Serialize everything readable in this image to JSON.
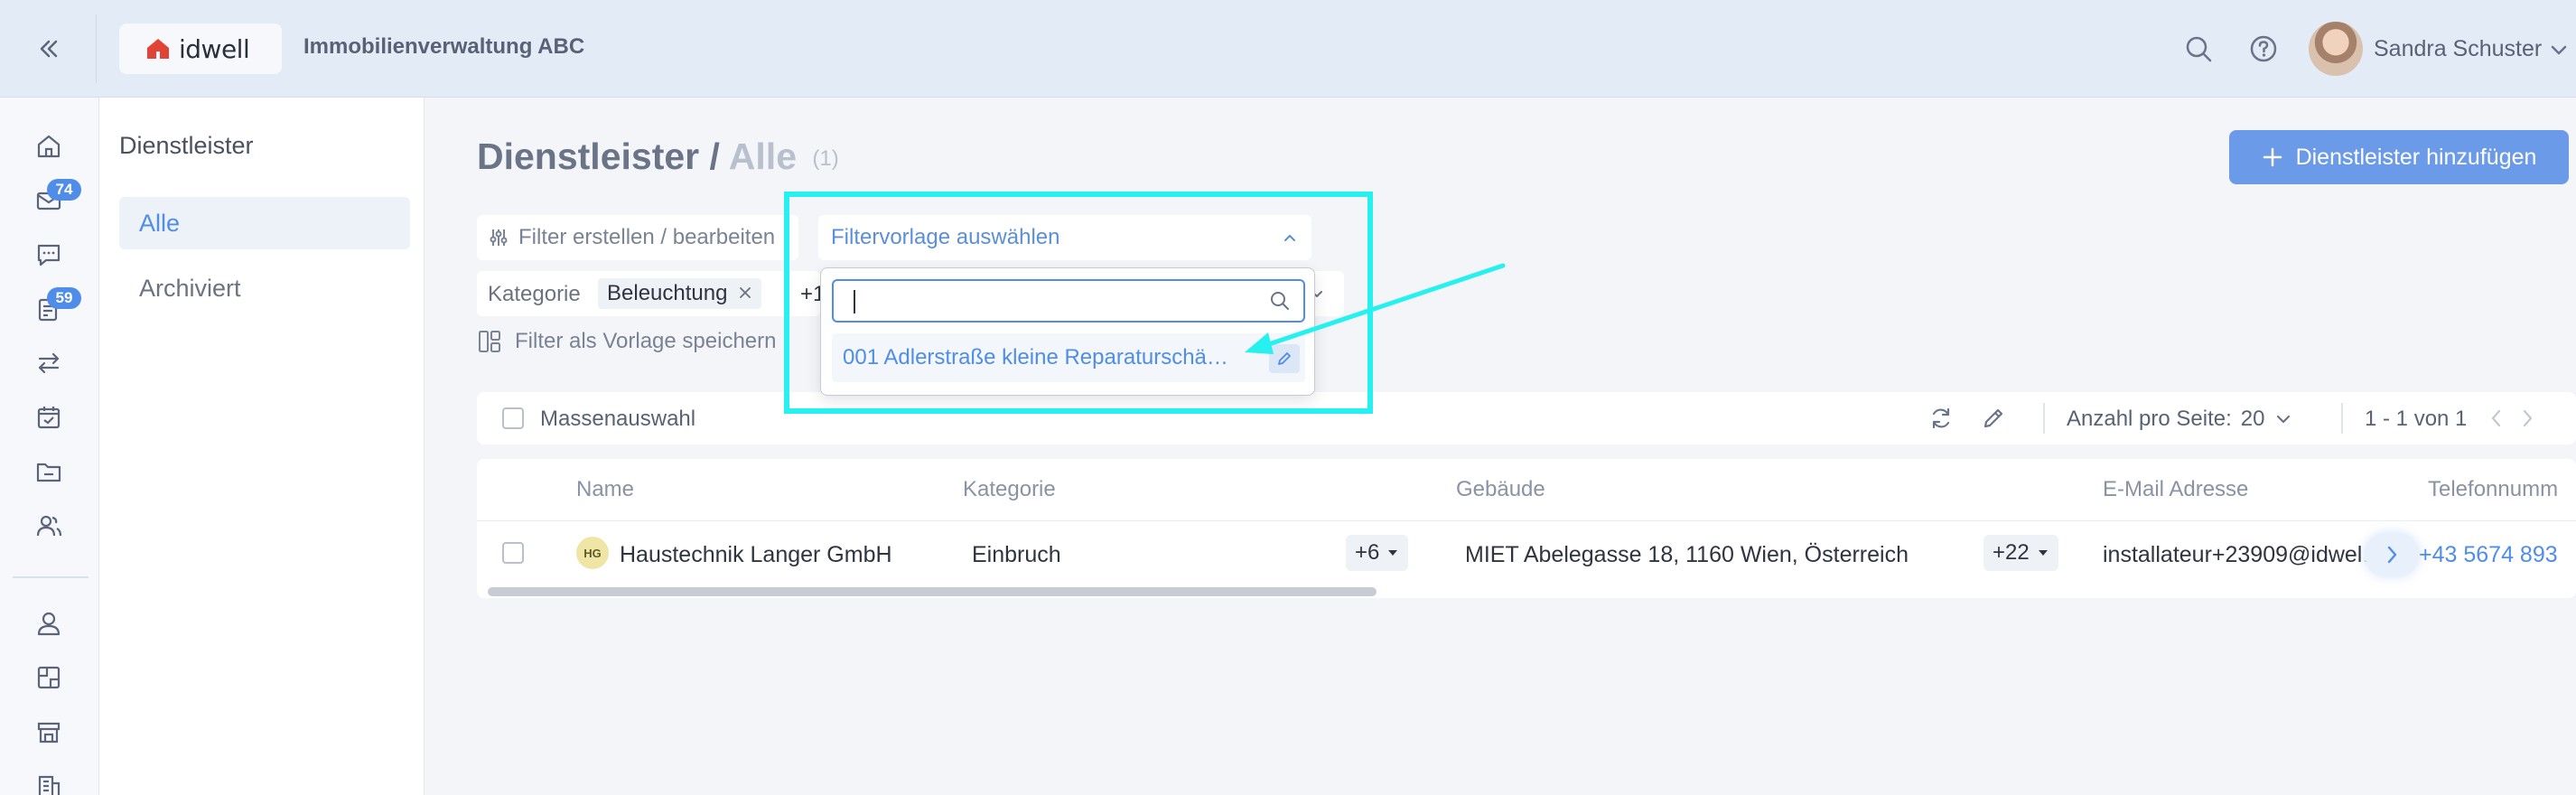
{
  "header": {
    "logo_text": "idwell",
    "company": "Immobilienverwaltung ABC",
    "user_name": "Sandra Schuster",
    "icons": [
      "collapse-icon",
      "search-icon",
      "help-icon",
      "chevron-down-icon"
    ]
  },
  "rail": {
    "icons": [
      "home-icon",
      "inbox-icon",
      "chat-icon",
      "tasks-icon",
      "transfer-icon",
      "calendar-check-icon",
      "folder-icon",
      "users-icon",
      "person-icon",
      "contract-icon",
      "store-icon",
      "building-icon"
    ],
    "badges": {
      "inbox": "74",
      "tasks": "59"
    }
  },
  "subnav": {
    "title": "Dienstleister",
    "items": [
      {
        "label": "Alle",
        "active": true
      },
      {
        "label": "Archiviert",
        "active": false
      }
    ]
  },
  "page": {
    "title": "Dienstleister",
    "separator": "/",
    "subtitle": "Alle",
    "count": "(1)",
    "add_button": "Dienstleister hinzufügen"
  },
  "filters": {
    "edit_label": "Filter erstellen / bearbeiten",
    "template_placeholder": "Filtervorlage auswählen",
    "category_label": "Kategorie",
    "category_chip": "Beleuchtung",
    "more_count": "+1",
    "save_template": "Filter als Vorlage speichern",
    "dropdown": {
      "search_value": "",
      "option": "001 Adlerstraße kleine Reparaturschä…"
    }
  },
  "toolbar": {
    "mass_select": "Massenauswahl",
    "per_page_label": "Anzahl pro Seite:",
    "per_page_value": "20",
    "range": "1 - 1 von 1"
  },
  "table": {
    "columns": [
      "Name",
      "Kategorie",
      "Gebäude",
      "E-Mail Adresse",
      "Telefonnumm"
    ],
    "rows": [
      {
        "initials": "HG",
        "name": "Haustechnik Langer GmbH",
        "category": "Einbruch",
        "category_more": "+6",
        "building": "MIET Abelegasse 18, 1160 Wien, Österreich",
        "building_more": "+22",
        "email": "installateur+23909@idwel…",
        "phone": "+43 5674 893"
      }
    ]
  },
  "colors": {
    "accent": "#4f8de8",
    "annotation": "#26f0f0",
    "topbar": "#e3ebf7"
  }
}
